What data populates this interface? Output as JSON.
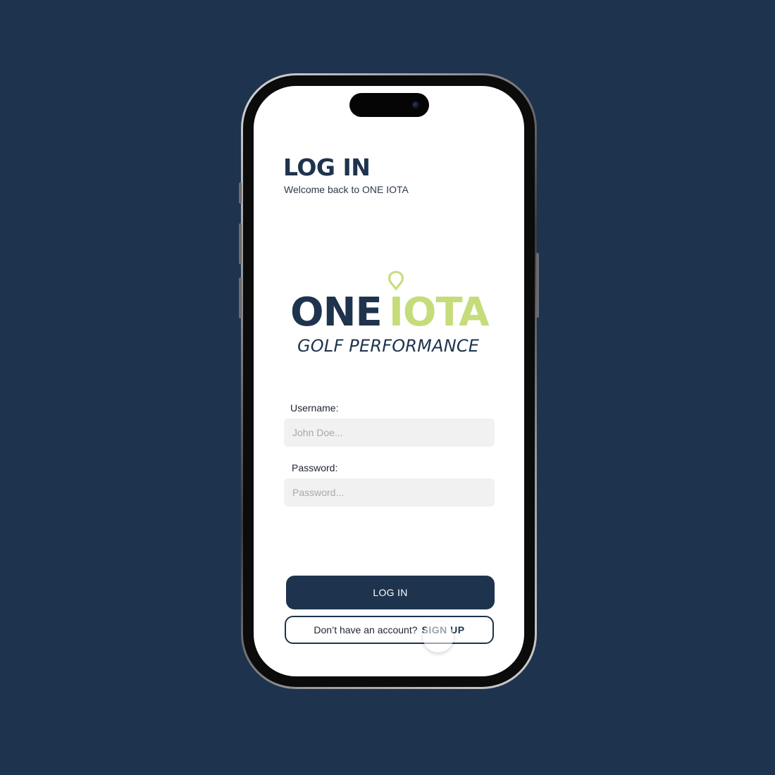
{
  "header": {
    "title": "LOG IN",
    "subtitle": "Welcome back to ONE IOTA"
  },
  "logo": {
    "word1": "ONE",
    "word2": "IOTA",
    "tagline": "GOLF PERFORMANCE",
    "icon": "location-pin-icon"
  },
  "form": {
    "username_label": "Username:",
    "username_placeholder": "John Doe...",
    "password_label": "Password:",
    "password_placeholder": "Password...",
    "login_label": "LOG IN",
    "signup_prompt": "Don’t have an account?",
    "signup_link": "SIGN UP"
  },
  "colors": {
    "background": "#1e334d",
    "brand_navy": "#1e334d",
    "brand_lime": "#c5dc7a",
    "input_bg": "#f1f1f1",
    "screen_bg": "#ffffff"
  }
}
